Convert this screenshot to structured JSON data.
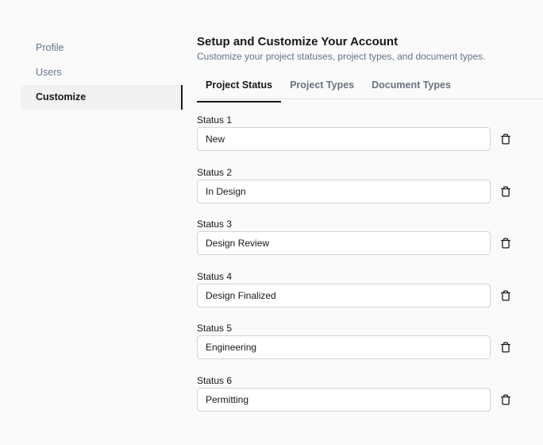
{
  "sidebar": {
    "items": [
      {
        "label": "Profile",
        "active": false
      },
      {
        "label": "Users",
        "active": false
      },
      {
        "label": "Customize",
        "active": true
      }
    ]
  },
  "header": {
    "title": "Setup and Customize Your Account",
    "subtitle": "Customize your project statuses, project types, and document types."
  },
  "tabs": [
    {
      "label": "Project Status",
      "active": true
    },
    {
      "label": "Project Types",
      "active": false
    },
    {
      "label": "Document Types",
      "active": false
    }
  ],
  "statuses": [
    {
      "label": "Status 1",
      "value": "New"
    },
    {
      "label": "Status 2",
      "value": "In Design"
    },
    {
      "label": "Status 3",
      "value": "Design Review"
    },
    {
      "label": "Status 4",
      "value": "Design Finalized"
    },
    {
      "label": "Status 5",
      "value": "Engineering"
    },
    {
      "label": "Status 6",
      "value": "Permitting"
    }
  ],
  "icons": {
    "delete": "trash-icon"
  },
  "colors": {
    "text": "#18181b",
    "muted": "#64748b",
    "border": "#d4d4d8",
    "active_bg": "#f1f1f2"
  }
}
